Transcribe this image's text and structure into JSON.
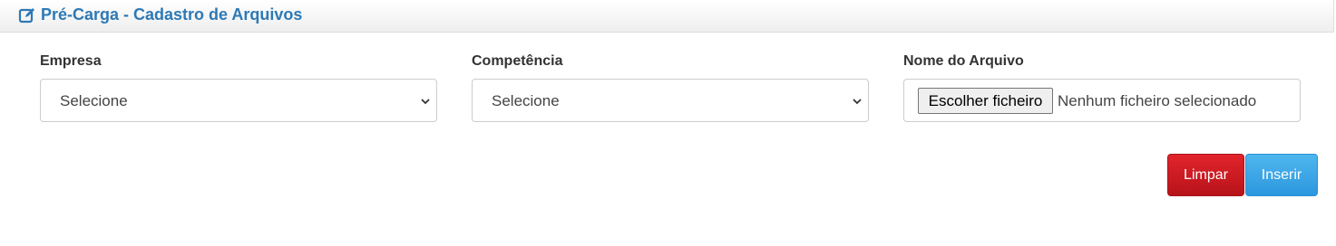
{
  "header": {
    "icon": "edit-icon",
    "title": "Pré-Carga - Cadastro de Arquivos",
    "title_color": "#2d79b5"
  },
  "form": {
    "empresa": {
      "label": "Empresa",
      "selected": "Selecione",
      "icon": "chevron-down-icon"
    },
    "competencia": {
      "label": "Competência",
      "selected": "Selecione",
      "icon": "chevron-down-icon"
    },
    "arquivo": {
      "label": "Nome do Arquivo",
      "button_label": "Escolher ficheiro",
      "status": "Nenhum ficheiro selecionado"
    }
  },
  "actions": {
    "clear_label": "Limpar",
    "clear_color": "#c9161d",
    "insert_label": "Inserir",
    "insert_color": "#38a5e6"
  }
}
